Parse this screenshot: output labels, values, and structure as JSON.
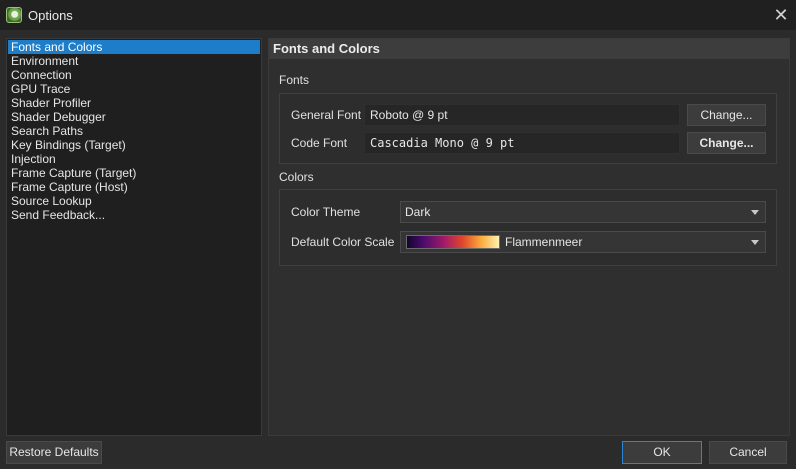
{
  "window": {
    "title": "Options"
  },
  "sidebar": {
    "items": [
      {
        "label": "Fonts and Colors",
        "selected": true
      },
      {
        "label": "Environment"
      },
      {
        "label": "Connection"
      },
      {
        "label": "GPU Trace"
      },
      {
        "label": "Shader Profiler"
      },
      {
        "label": "Shader Debugger"
      },
      {
        "label": "Search Paths"
      },
      {
        "label": "Key Bindings (Target)"
      },
      {
        "label": "Injection"
      },
      {
        "label": "Frame Capture (Target)"
      },
      {
        "label": "Frame Capture (Host)"
      },
      {
        "label": "Source Lookup"
      },
      {
        "label": "Send Feedback..."
      }
    ]
  },
  "main": {
    "title": "Fonts and Colors",
    "fonts": {
      "group_title": "Fonts",
      "general_font": {
        "label": "General Font",
        "value": "Roboto @ 9 pt",
        "button": "Change..."
      },
      "code_font": {
        "label": "Code Font",
        "value": "Cascadia Mono @ 9 pt",
        "button": "Change..."
      }
    },
    "colors": {
      "group_title": "Colors",
      "color_theme": {
        "label": "Color Theme",
        "value": "Dark"
      },
      "default_color_scale": {
        "label": "Default Color Scale",
        "value": "Flammenmeer"
      }
    }
  },
  "footer": {
    "restore_defaults": "Restore Defaults",
    "ok": "OK",
    "cancel": "Cancel"
  },
  "colors": {
    "accent": "#1e7dc8",
    "background": "#2b2b2b"
  },
  "icons": {
    "app": "app-icon",
    "close": "close-icon",
    "dropdown": "chevron-down-icon"
  }
}
